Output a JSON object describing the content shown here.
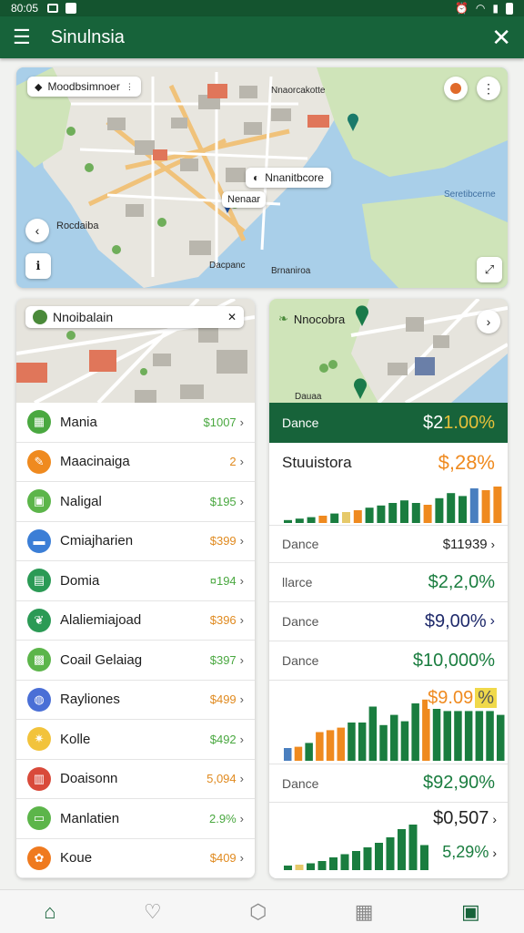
{
  "status": {
    "time": "80:05",
    "icons": [
      "image-icon",
      "notification-icon"
    ],
    "right_icons": [
      "alarm-icon",
      "wifi-icon",
      "signal-icon",
      "battery-icon"
    ]
  },
  "appbar": {
    "title": "Sinulnsia",
    "menu_icon": "menu-icon",
    "close_icon": "close-icon"
  },
  "top_map": {
    "search_chip": "Moodbsimnoer",
    "chip_center": "Nnanitbcore",
    "chip_pin": "Nenaar",
    "label_left": "Rocdaiba",
    "label_top": "Nnaorcakotte",
    "label_bottom": "Dacpanc",
    "label_bottom2": "Brnaniroa",
    "label_water": "Seretibcerne"
  },
  "left_map": {
    "title": "Nnoibalain"
  },
  "right_map": {
    "title": "Nnocobra",
    "label": "Dauaa"
  },
  "list": [
    {
      "label": "Mania",
      "value": "$1007",
      "color": "#4aa840",
      "icon": "grid-icon"
    },
    {
      "label": "Maacinaiga",
      "value": "2",
      "color": "#ef8a1f",
      "icon": "tools-icon"
    },
    {
      "label": "Naligal",
      "value": "$195",
      "color": "#5cb54a",
      "icon": "image-icon"
    },
    {
      "label": "Cmiajharien",
      "value": "$399",
      "color": "#3b7ed6",
      "icon": "folder-icon"
    },
    {
      "label": "Domia",
      "value": "¤194",
      "color": "#2b9a55",
      "icon": "chat-icon"
    },
    {
      "label": "Alaliemiajoad",
      "value": "$396",
      "color": "#2b9a55",
      "icon": "leaf-icon"
    },
    {
      "label": "Coail Gelaiag",
      "value": "$397",
      "color": "#5cb54a",
      "icon": "calc-icon"
    },
    {
      "label": "Rayliones",
      "value": "$499",
      "color": "#4a6fd6",
      "icon": "globe-icon"
    },
    {
      "label": "Kolle",
      "value": "$492",
      "color": "#f2c33c",
      "icon": "sun-icon"
    },
    {
      "label": "Doaisonn",
      "value": "5,094",
      "color": "#d94a3a",
      "icon": "briefcase-icon"
    },
    {
      "label": "Manlatien",
      "value": "2.9%",
      "color": "#5cb54a",
      "icon": "card-icon"
    },
    {
      "label": "Koue",
      "value": "$409",
      "color": "#ef7a1f",
      "icon": "flower-icon"
    }
  ],
  "colors": {
    "green": "#1a7d3f",
    "orange": "#ef8a1f",
    "lightgreen": "#4aa840",
    "navy": "#1f2a6b"
  },
  "stats": {
    "header_label": "Dance",
    "header_value": "$2",
    "header_value_hi": "1.00%",
    "title": "Stuuistora",
    "title_value": "$,28%",
    "rows": [
      {
        "label": "Dance",
        "value": "$11939"
      },
      {
        "label": "llarce",
        "value": "$2,2,0%"
      },
      {
        "label": "Dance",
        "value": "$9,00%"
      },
      {
        "label": "Dance",
        "value": "$10,000%"
      }
    ],
    "mid_value": "$9.09",
    "mid_badge": "%",
    "row5": {
      "label": "Dance",
      "value": "$92,90%"
    },
    "foot_value1": "$0,507",
    "foot_value2": "5,29%"
  },
  "bars1": [
    {
      "v": 0.08,
      "c": "g"
    },
    {
      "v": 0.12,
      "c": "g"
    },
    {
      "v": 0.16,
      "c": "g"
    },
    {
      "v": 0.2,
      "c": "o"
    },
    {
      "v": 0.26,
      "c": "g"
    },
    {
      "v": 0.3,
      "c": "y"
    },
    {
      "v": 0.35,
      "c": "o"
    },
    {
      "v": 0.42,
      "c": "g"
    },
    {
      "v": 0.48,
      "c": "g"
    },
    {
      "v": 0.55,
      "c": "g"
    },
    {
      "v": 0.62,
      "c": "g"
    },
    {
      "v": 0.55,
      "c": "g"
    },
    {
      "v": 0.5,
      "c": "o"
    },
    {
      "v": 0.68,
      "c": "g"
    },
    {
      "v": 0.82,
      "c": "g"
    },
    {
      "v": 0.74,
      "c": "g"
    },
    {
      "v": 0.95,
      "c": "b"
    },
    {
      "v": 0.9,
      "c": "o"
    },
    {
      "v": 1.0,
      "c": "o"
    }
  ],
  "bars2": [
    {
      "v": 0.2,
      "c": "b"
    },
    {
      "v": 0.22,
      "c": "o"
    },
    {
      "v": 0.28,
      "c": "g"
    },
    {
      "v": 0.45,
      "c": "o"
    },
    {
      "v": 0.48,
      "c": "o"
    },
    {
      "v": 0.52,
      "c": "o"
    },
    {
      "v": 0.6,
      "c": "g"
    },
    {
      "v": 0.6,
      "c": "g"
    },
    {
      "v": 0.85,
      "c": "g"
    },
    {
      "v": 0.56,
      "c": "g"
    },
    {
      "v": 0.72,
      "c": "g"
    },
    {
      "v": 0.62,
      "c": "g"
    },
    {
      "v": 0.9,
      "c": "g"
    },
    {
      "v": 0.96,
      "c": "o"
    },
    {
      "v": 0.88,
      "c": "g"
    },
    {
      "v": 0.78,
      "c": "g"
    },
    {
      "v": 0.78,
      "c": "g"
    },
    {
      "v": 0.78,
      "c": "g"
    },
    {
      "v": 0.78,
      "c": "g"
    },
    {
      "v": 0.78,
      "c": "g"
    },
    {
      "v": 0.72,
      "c": "g"
    }
  ],
  "bars3": [
    {
      "v": 0.1,
      "c": "g"
    },
    {
      "v": 0.12,
      "c": "y"
    },
    {
      "v": 0.15,
      "c": "g"
    },
    {
      "v": 0.2,
      "c": "g"
    },
    {
      "v": 0.28,
      "c": "g"
    },
    {
      "v": 0.35,
      "c": "g"
    },
    {
      "v": 0.42,
      "c": "g"
    },
    {
      "v": 0.5,
      "c": "g"
    },
    {
      "v": 0.6,
      "c": "g"
    },
    {
      "v": 0.72,
      "c": "g"
    },
    {
      "v": 0.9,
      "c": "g"
    },
    {
      "v": 1.0,
      "c": "g"
    },
    {
      "v": 0.55,
      "c": "g"
    }
  ],
  "bottomnav": [
    {
      "name": "home-icon",
      "glyph": "⌂",
      "active": true
    },
    {
      "name": "heart-icon",
      "glyph": "♡",
      "active": false
    },
    {
      "name": "bookmark-icon",
      "glyph": "⬡",
      "active": false
    },
    {
      "name": "calendar-icon",
      "glyph": "▦",
      "active": false
    },
    {
      "name": "wallet-icon",
      "glyph": "▣",
      "active": true
    }
  ]
}
